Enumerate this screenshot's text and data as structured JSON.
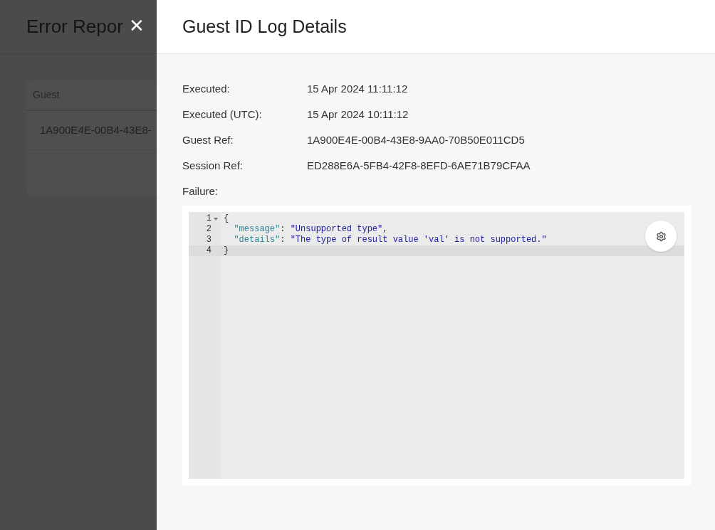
{
  "background_page": {
    "title": "Error Repor",
    "table": {
      "columns": [
        "Guest"
      ],
      "rows": [
        [
          "1A900E4E-00B4-43E8-"
        ]
      ]
    }
  },
  "drawer": {
    "title": "Guest ID Log Details",
    "close": "✕",
    "fields": [
      {
        "label": "Executed:",
        "value": "15 Apr 2024 11:11:12"
      },
      {
        "label": "Executed (UTC):",
        "value": "15 Apr 2024 10:11:12"
      },
      {
        "label": "Guest Ref:",
        "value": "1A900E4E-00B4-43E8-9AA0-70B50E011CD5"
      },
      {
        "label": "Session Ref:",
        "value": "ED288E6A-5FB4-42F8-8EFD-6AE71B79CFAA"
      }
    ],
    "failure_label": "Failure:",
    "editor": {
      "lines": [
        {
          "number": "1",
          "foldable": true,
          "active": false,
          "tokens": [
            {
              "kind": "punct",
              "text": "{"
            }
          ]
        },
        {
          "number": "2",
          "foldable": false,
          "active": false,
          "tokens": [
            {
              "kind": "key",
              "text": "\"message\""
            },
            {
              "kind": "punct",
              "text": ": "
            },
            {
              "kind": "string",
              "text": "\"Unsupported type\""
            },
            {
              "kind": "punct",
              "text": ","
            }
          ]
        },
        {
          "number": "3",
          "foldable": false,
          "active": false,
          "tokens": [
            {
              "kind": "key",
              "text": "\"details\""
            },
            {
              "kind": "punct",
              "text": ": "
            },
            {
              "kind": "string",
              "text": "\"The type of result value 'val' is not supported.\""
            }
          ]
        },
        {
          "number": "4",
          "foldable": false,
          "active": true,
          "tokens": [
            {
              "kind": "punct",
              "text": "}"
            }
          ]
        }
      ]
    }
  }
}
